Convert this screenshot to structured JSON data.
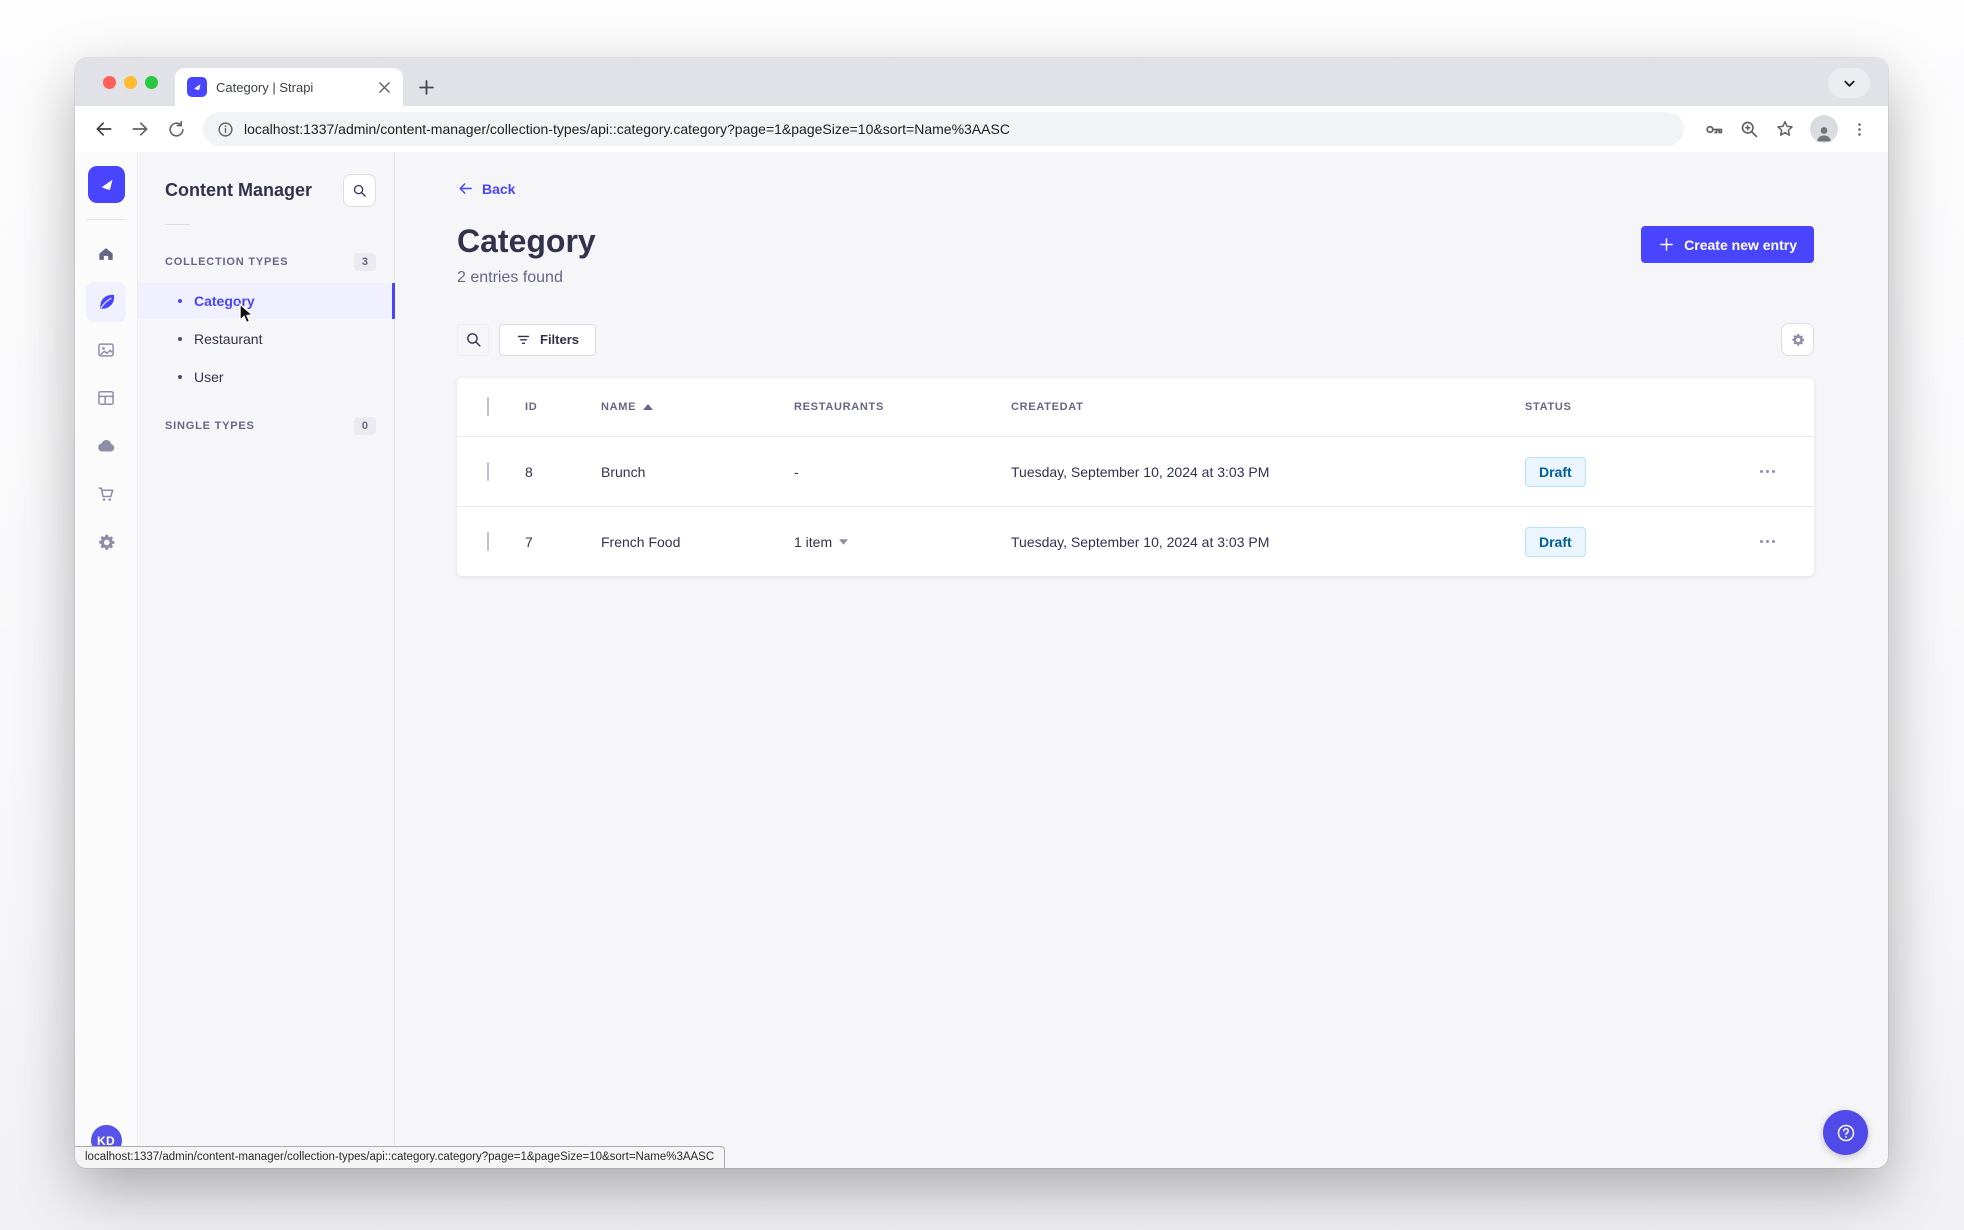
{
  "browser": {
    "tab_title": "Category | Strapi",
    "new_tab_label": "+",
    "url": "localhost:1337/admin/content-manager/collection-types/api::category.category?page=1&pageSize=10&sort=Name%3AASC"
  },
  "statusbar_url": "localhost:1337/admin/content-manager/collection-types/api::category.category?page=1&pageSize=10&sort=Name%3AASC",
  "rail": {
    "avatar_initials": "KD"
  },
  "subnav": {
    "title": "Content Manager",
    "collection_types_label": "COLLECTION TYPES",
    "collection_types_count": "3",
    "items": [
      {
        "label": "Category",
        "active": true
      },
      {
        "label": "Restaurant",
        "active": false
      },
      {
        "label": "User",
        "active": false
      }
    ],
    "single_types_label": "SINGLE TYPES",
    "single_types_count": "0"
  },
  "main": {
    "back_label": "Back",
    "title": "Category",
    "subtitle": "2 entries found",
    "create_button_label": "Create new entry",
    "filters_label": "Filters",
    "table": {
      "headers": {
        "id": "ID",
        "name": "NAME",
        "restaurants": "RESTAURANTS",
        "createdat": "CREATEDAT",
        "status": "STATUS"
      },
      "sort_column": "NAME",
      "sort_direction": "ascending",
      "rows": [
        {
          "id": "8",
          "name": "Brunch",
          "restaurants": "-",
          "createdat": "Tuesday, September 10, 2024 at 3:03 PM",
          "status": "Draft"
        },
        {
          "id": "7",
          "name": "French Food",
          "restaurants": "1 item",
          "createdat": "Tuesday, September 10, 2024 at 3:03 PM",
          "status": "Draft"
        }
      ]
    }
  },
  "colors": {
    "accent": "#4945ff",
    "active_item_bg": "#f0f0ff",
    "draft_bg": "#eaf5ff",
    "draft_border": "#b8e1ff",
    "draft_text": "#006096"
  }
}
